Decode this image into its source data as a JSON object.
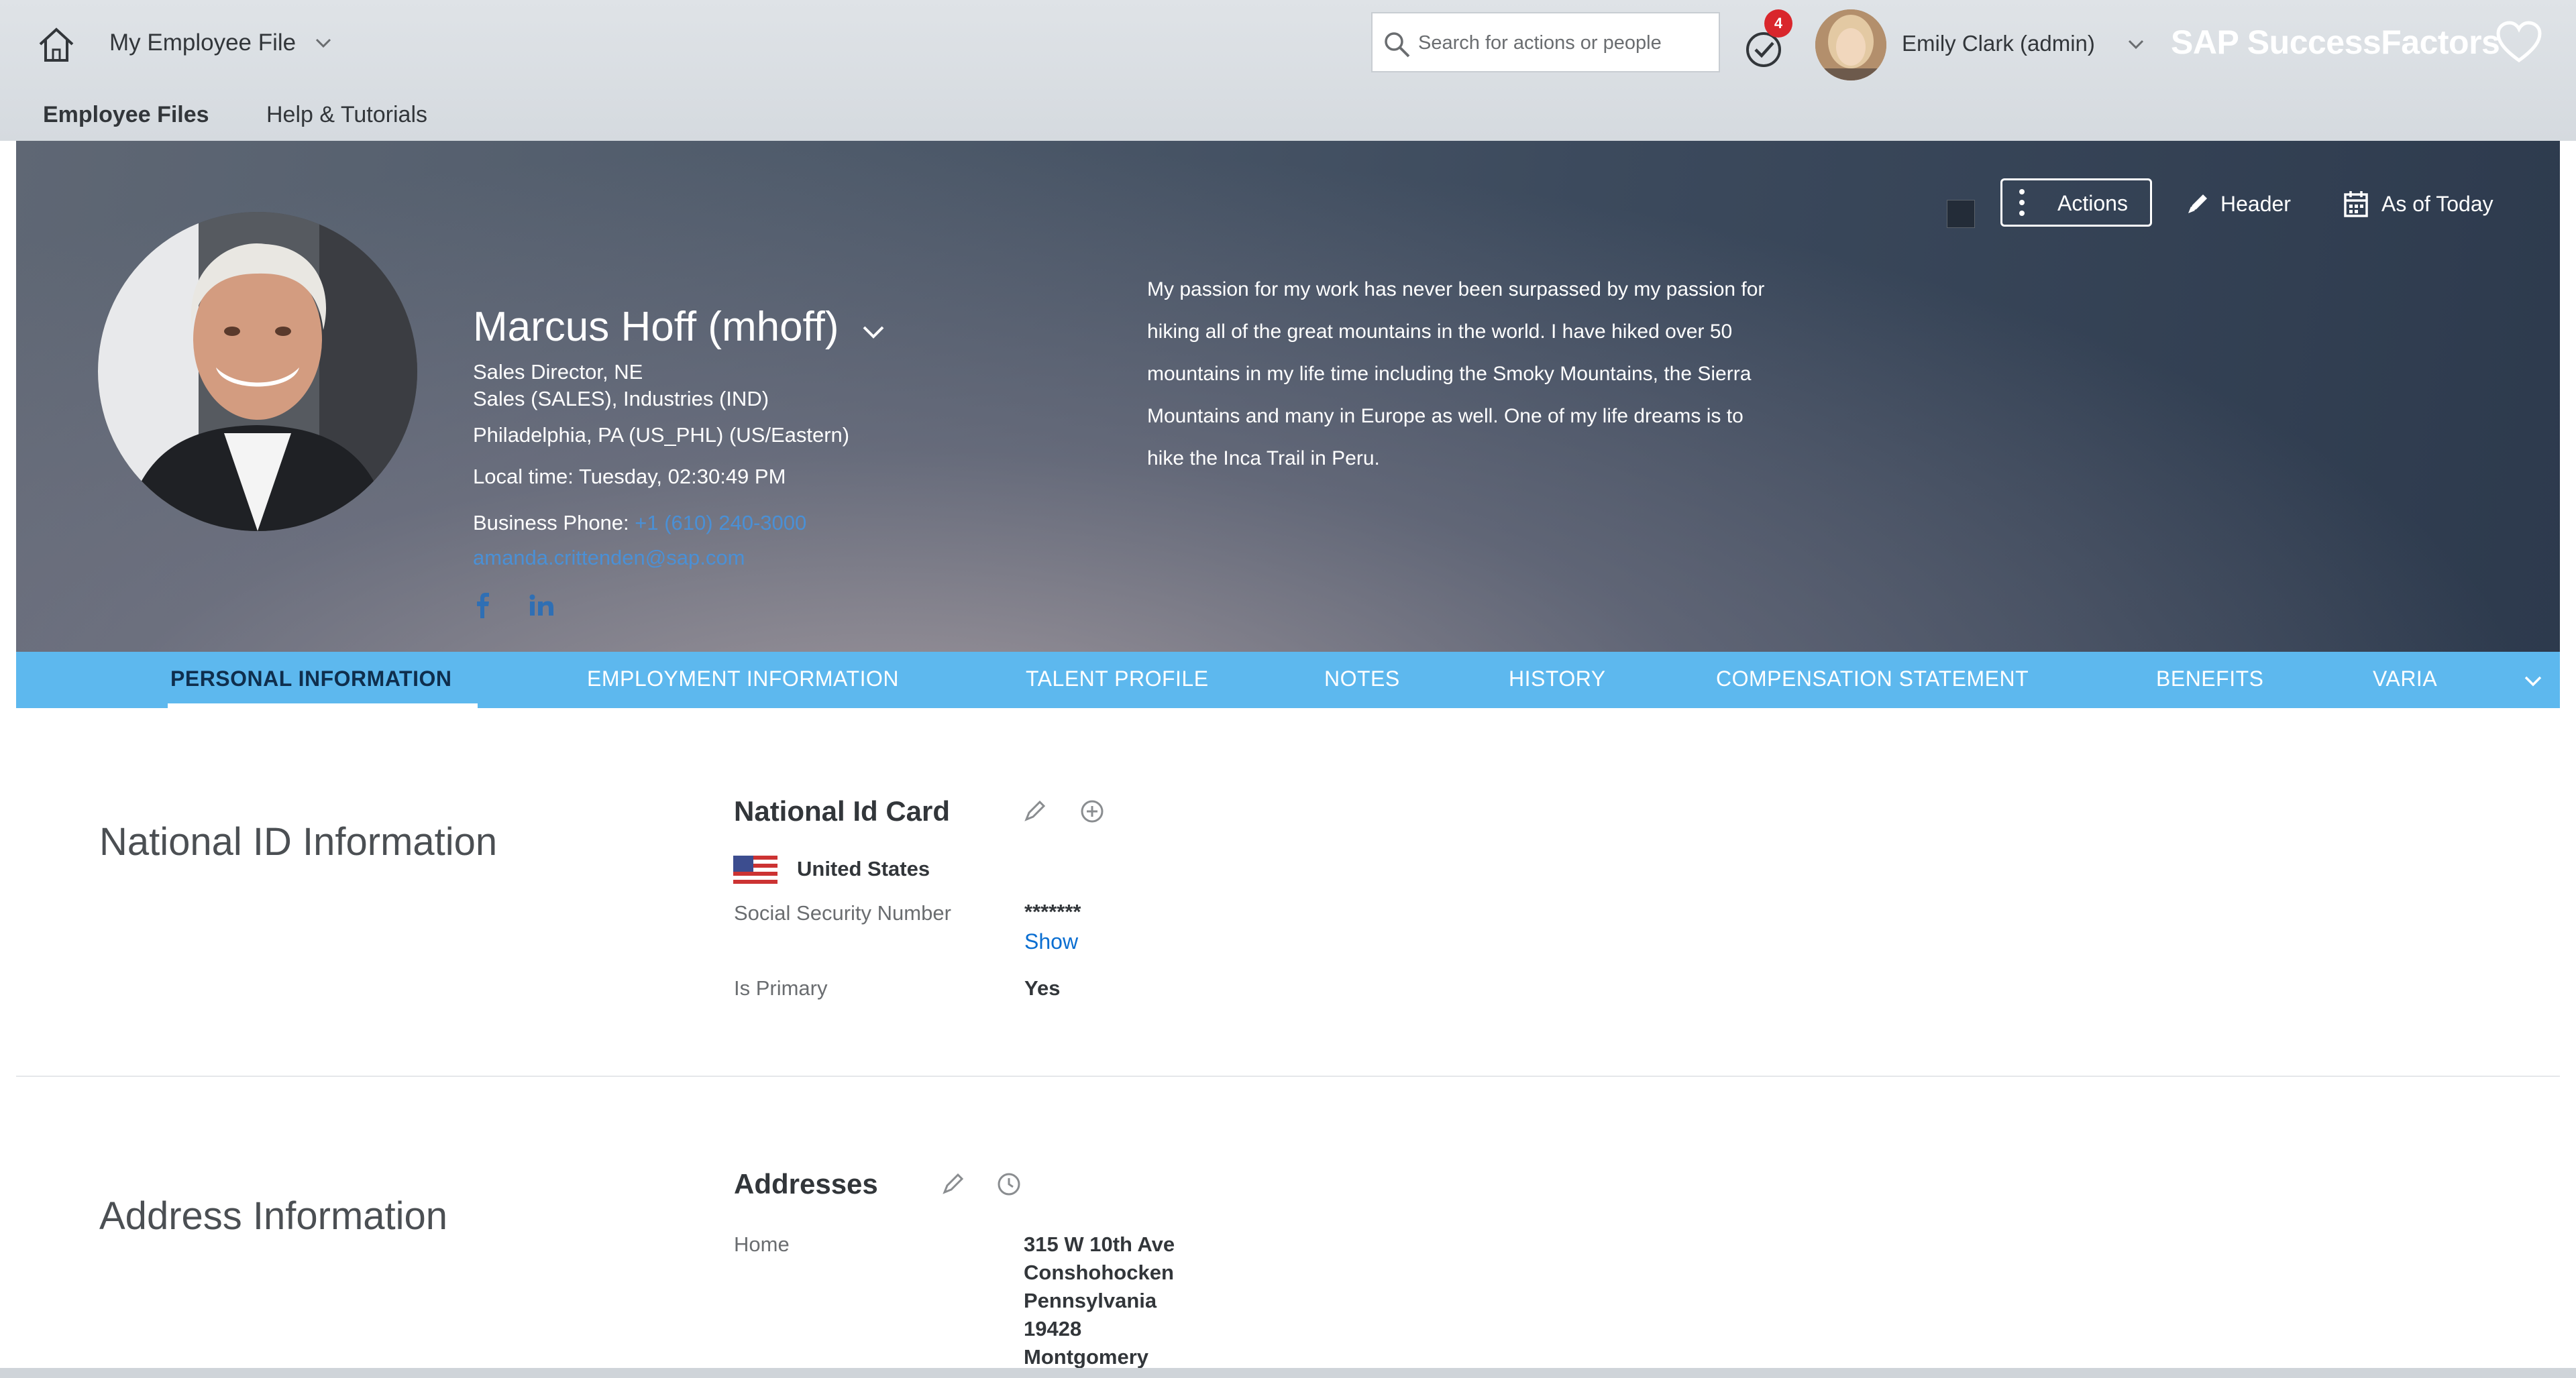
{
  "shell": {
    "app_title": "My Employee File",
    "search_placeholder": "Search for actions or people",
    "notification_count": "4",
    "user_name": "Emily Clark (admin)",
    "brand": "SAP SuccessFactors",
    "subnav": {
      "employee_files": "Employee Files",
      "help_tutorials": "Help & Tutorials"
    }
  },
  "header": {
    "actions_label": "Actions",
    "header_label": "Header",
    "as_of_label": "As of Today",
    "employee": {
      "name": "Marcus Hoff (mhoff)",
      "title": "Sales Director, NE",
      "department": "Sales (SALES), Industries (IND)",
      "location": "Philadelphia, PA (US_PHL) (US/Eastern)",
      "local_time": "Local time: Tuesday, 02:30:49 PM",
      "phone_label": "Business Phone:",
      "phone_value": "+1 (610) 240-3000",
      "email": "amanda.crittenden@sap.com"
    },
    "bio": "My passion for my work has never been surpassed by my passion for hiking all of the great mountains in the world. I have hiked over 50 mountains in my life time including the Smoky Mountains, the Sierra Mountains and many in Europe as well. One of my life dreams is to hike the Inca Trail in Peru."
  },
  "tabs": [
    {
      "label": "PERSONAL INFORMATION",
      "active": true
    },
    {
      "label": "EMPLOYMENT INFORMATION"
    },
    {
      "label": "TALENT PROFILE"
    },
    {
      "label": "NOTES"
    },
    {
      "label": "HISTORY"
    },
    {
      "label": "COMPENSATION STATEMENT"
    },
    {
      "label": "BENEFITS"
    },
    {
      "label": "VARIA"
    }
  ],
  "national_id": {
    "section_title": "National ID Information",
    "card_title": "National Id Card",
    "country": "United States",
    "ssn_label": "Social Security Number",
    "ssn_value": "*******",
    "show_label": "Show",
    "primary_label": "Is Primary",
    "primary_value": "Yes"
  },
  "address": {
    "section_title": "Address Information",
    "card_title": "Addresses",
    "home_label": "Home",
    "lines": [
      "315 W 10th Ave",
      "Conshohocken",
      "Pennsylvania",
      "19428",
      "Montgomery"
    ]
  },
  "colors": {
    "tab_bar": "#5db8ee",
    "link": "#0a6ed1",
    "badge": "#d9262c"
  },
  "icons": [
    "home-icon",
    "chevron-down-icon",
    "search-icon",
    "todo-icon",
    "heart-icon",
    "more-vertical-icon",
    "pencil-icon",
    "calendar-icon",
    "facebook-icon",
    "linkedin-icon",
    "us-flag-icon",
    "history-icon"
  ]
}
